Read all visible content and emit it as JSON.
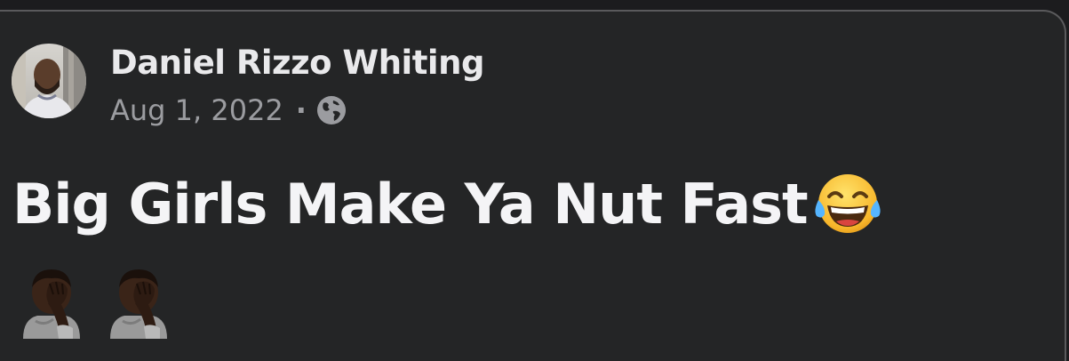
{
  "post": {
    "author_name": "Daniel Rizzo Whiting",
    "date": "Aug 1, 2022",
    "separator": "·",
    "audience_icon": "globe-icon",
    "text": "Big Girls Make Ya Nut Fast",
    "text_emoji": "face-with-tears-of-joy",
    "emojis": [
      "person-facepalming",
      "person-facepalming"
    ]
  },
  "colors": {
    "card_background": "#242526",
    "author_text": "#e9e9eb",
    "meta_text": "#9b9ca0",
    "body_text": "#f4f4f6"
  }
}
